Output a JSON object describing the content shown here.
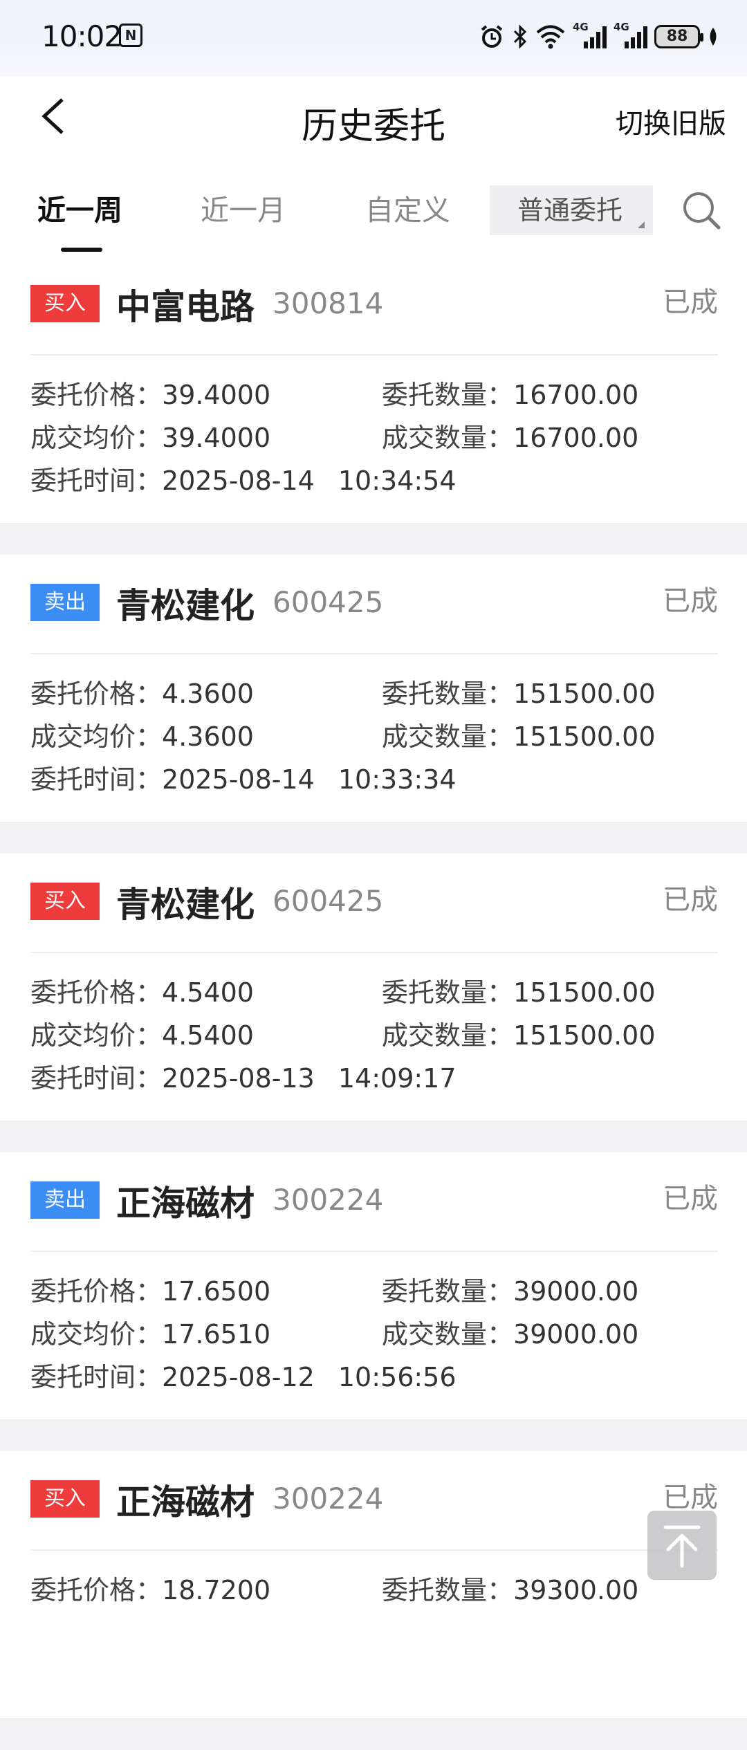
{
  "status_bar": {
    "time": "10:02",
    "nfc": "N",
    "battery": "88",
    "net1": "4G",
    "net2": "4G"
  },
  "header": {
    "title": "历史委托",
    "switch_label": "切换旧版"
  },
  "tabs": [
    {
      "label": "近一周",
      "active": true
    },
    {
      "label": "近一月",
      "active": false
    },
    {
      "label": "自定义",
      "active": false
    }
  ],
  "filter": {
    "label": "普通委托"
  },
  "labels": {
    "order_price": "委托价格：",
    "order_qty": "委托数量：",
    "avg_price": "成交均价：",
    "deal_qty": "成交数量：",
    "order_time": "委托时间："
  },
  "orders": [
    {
      "side": "买入",
      "side_type": "buy",
      "name": "中富电路",
      "code": "300814",
      "status": "已成",
      "order_price": "39.4000",
      "order_qty": "16700.00",
      "avg_price": "39.4000",
      "deal_qty": "16700.00",
      "date": "2025-08-14",
      "time": "10:34:54"
    },
    {
      "side": "卖出",
      "side_type": "sell",
      "name": "青松建化",
      "code": "600425",
      "status": "已成",
      "order_price": "4.3600",
      "order_qty": "151500.00",
      "avg_price": "4.3600",
      "deal_qty": "151500.00",
      "date": "2025-08-14",
      "time": "10:33:34"
    },
    {
      "side": "买入",
      "side_type": "buy",
      "name": "青松建化",
      "code": "600425",
      "status": "已成",
      "order_price": "4.5400",
      "order_qty": "151500.00",
      "avg_price": "4.5400",
      "deal_qty": "151500.00",
      "date": "2025-08-13",
      "time": "14:09:17"
    },
    {
      "side": "卖出",
      "side_type": "sell",
      "name": "正海磁材",
      "code": "300224",
      "status": "已成",
      "order_price": "17.6500",
      "order_qty": "39000.00",
      "avg_price": "17.6510",
      "deal_qty": "39000.00",
      "date": "2025-08-12",
      "time": "10:56:56"
    },
    {
      "side": "买入",
      "side_type": "buy",
      "name": "正海磁材",
      "code": "300224",
      "status": "已成",
      "order_price": "18.7200",
      "order_qty": "39300.00"
    }
  ],
  "icons": {
    "back": "chevron-left-icon",
    "search": "search-icon",
    "to_top": "arrow-up-to-top-icon"
  }
}
